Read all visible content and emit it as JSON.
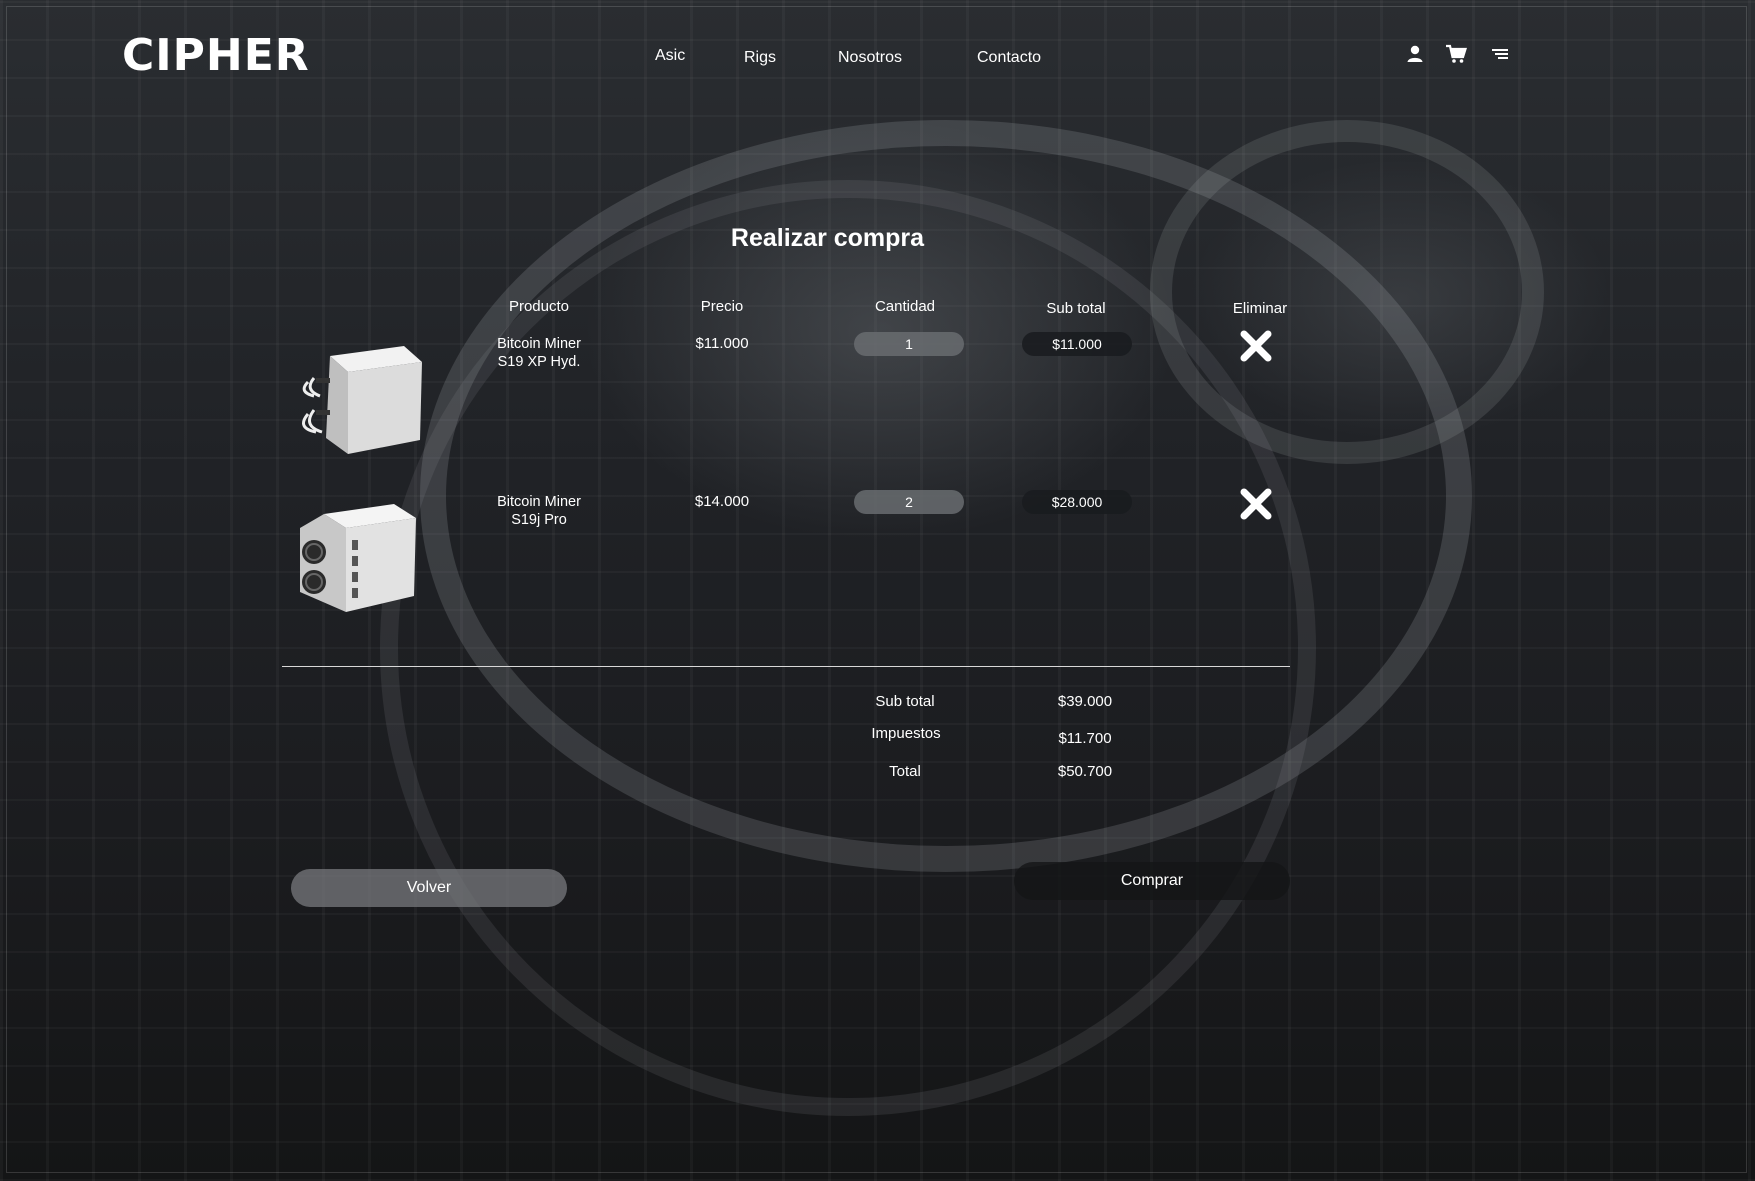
{
  "brand": {
    "logo": "CIPHER"
  },
  "nav": {
    "links": [
      "Asic",
      "Rigs",
      "Nosotros",
      "Contacto"
    ],
    "icons": [
      "user-icon",
      "cart-icon",
      "menu-icon"
    ]
  },
  "page": {
    "title": "Realizar compra"
  },
  "table": {
    "headers": [
      "Producto",
      "Precio",
      "Cantidad",
      "Sub total",
      "Eliminar"
    ],
    "rows": [
      {
        "product_line1": "Bitcoin Miner",
        "product_line2": "S19 XP Hyd.",
        "price": "$11.000",
        "quantity": "1",
        "subtotal": "$11.000"
      },
      {
        "product_line1": "Bitcoin Miner",
        "product_line2": "S19j Pro",
        "price": "$14.000",
        "quantity": "2",
        "subtotal": "$28.000"
      }
    ]
  },
  "summary": {
    "subtotal_label": "Sub total",
    "subtotal_value": "$39.000",
    "tax_label": "Impuestos",
    "tax_value": "$11.700",
    "total_label": "Total",
    "total_value": "$50.700"
  },
  "actions": {
    "back_label": "Volver",
    "buy_label": "Comprar"
  },
  "colors": {
    "text": "#ffffff",
    "background": "#1f2124",
    "pill_light": "#6a6c70",
    "pill_dark": "#191b1e"
  }
}
